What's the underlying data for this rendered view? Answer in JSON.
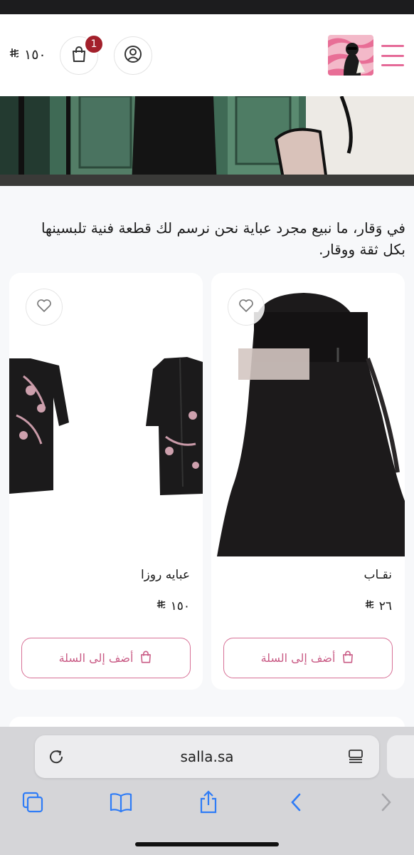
{
  "header": {
    "cart_total": "١٥٠",
    "currency_symbol": "⃁",
    "cart_count": "1",
    "icons": [
      "cart-icon",
      "account-icon",
      "menu-icon",
      "logo"
    ]
  },
  "tagline": "في وَقار، ما نبيع مجرد عباية نحن نرسم لك قطعة فنية تلبسينها بكل ثقة ووقار.",
  "products": [
    {
      "name": "نقـاب",
      "price": "٢٦",
      "add_label": "أضف إلى السلة"
    },
    {
      "name": "عبايه روزا",
      "price": "١٥٠",
      "add_label": "أضف إلى السلة"
    }
  ],
  "browser": {
    "url": "salla.sa"
  },
  "colors": {
    "accent": "#d77096",
    "badge": "#a3202b",
    "toolbar_icon": "#2f7cf6"
  }
}
